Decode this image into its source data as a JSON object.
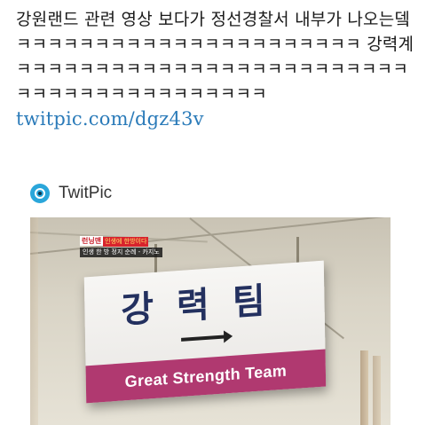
{
  "tweet": {
    "text": "강원랜드 관련 영상 보다가 정선경찰서 내부가 나오는뎈ㅋㅋㅋㅋㅋㅋㅋㅋㅋㅋㅋㅋㅋㅋㅋㅋㅋㅋㅋㅋㅋㅋ 강력계ㅋㅋㅋㅋㅋㅋㅋㅋㅋㅋㅋㅋㅋㅋㅋㅋㅋㅋㅋㅋㅋㅋㅋㅋㅋㅋㅋㅋㅋㅋㅋㅋㅋㅋㅋㅋㅋㅋㅋㅋㅋ ",
    "link": "twitpic.com/dgz43v"
  },
  "card": {
    "source": "TwitPic",
    "icon": "twitpic-icon",
    "photo": {
      "overlay_logo": "런닝맨",
      "overlay_sub": "인생에 한방이다",
      "overlay_caption": "인생 한 방 정지 순례 - 카지노",
      "sign_korean": "강력팀",
      "sign_english": "Great Strength Team",
      "sign_color": "#b03970"
    }
  }
}
